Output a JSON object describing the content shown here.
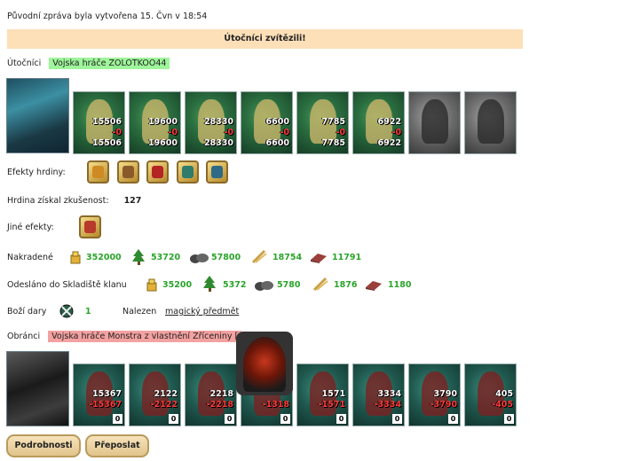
{
  "header": {
    "created": "Původní zpráva byla vytvořena 15. Čvn v 18:54"
  },
  "banner": {
    "text": "Útočníci zvítězili!"
  },
  "attackers": {
    "label": "Útočníci",
    "army": "Vojska hráče ZOLOTKOO44",
    "units": [
      {
        "a": "15506",
        "b": "-0",
        "c": "15506"
      },
      {
        "a": "19600",
        "b": "-0",
        "c": "19600"
      },
      {
        "a": "28330",
        "b": "-0",
        "c": "28330"
      },
      {
        "a": "6600",
        "b": "-0",
        "c": "6600"
      },
      {
        "a": "7785",
        "b": "-0",
        "c": "7785"
      },
      {
        "a": "6922",
        "b": "-0",
        "c": "6922"
      }
    ]
  },
  "hero_effects": {
    "label": "Efekty hrdiny:"
  },
  "experience": {
    "label": "Hrdina získal zkušenost:",
    "value": "127"
  },
  "other_effects": {
    "label": "Jiné efekty:"
  },
  "loot": {
    "label": "Nakradené",
    "values": [
      "352000",
      "53720",
      "57800",
      "18754",
      "11791"
    ]
  },
  "clan": {
    "label": "Odesláno do Skladiště klanu",
    "values": [
      "35200",
      "5372",
      "5780",
      "1876",
      "1180"
    ]
  },
  "gifts": {
    "label": "Boží dary",
    "value": "1",
    "found_label": "Nalezen",
    "found_item": "magický předmět"
  },
  "defenders": {
    "label": "Obránci",
    "army": "Vojska hráče Monstra z vlastnění Zříceniny [",
    "units": [
      {
        "a": "15367",
        "b": "-15367",
        "z": "0"
      },
      {
        "a": "2122",
        "b": "-2122",
        "z": "0"
      },
      {
        "a": "2218",
        "b": "-2218",
        "z": "0"
      },
      {
        "a": "",
        "b": "-1318",
        "z": "0"
      },
      {
        "a": "1571",
        "b": "-1571",
        "z": "0"
      },
      {
        "a": "3334",
        "b": "-3334",
        "z": "0"
      },
      {
        "a": "3790",
        "b": "-3790",
        "z": "0"
      },
      {
        "a": "405",
        "b": "-405",
        "z": "0"
      }
    ]
  },
  "buttons": {
    "details": "Podrobnosti",
    "forward": "Přeposlat"
  },
  "colors": {
    "banner": "#fddfb8",
    "attacker_tag": "#9ef59a",
    "defender_tag": "#f4a1a1",
    "positive": "#2aa52a",
    "loss": "#ff3b3b"
  },
  "icons": [
    "gold-icon",
    "wood-icon",
    "ore-icon",
    "wheat-icon",
    "brick-icon",
    "gift-icon"
  ]
}
